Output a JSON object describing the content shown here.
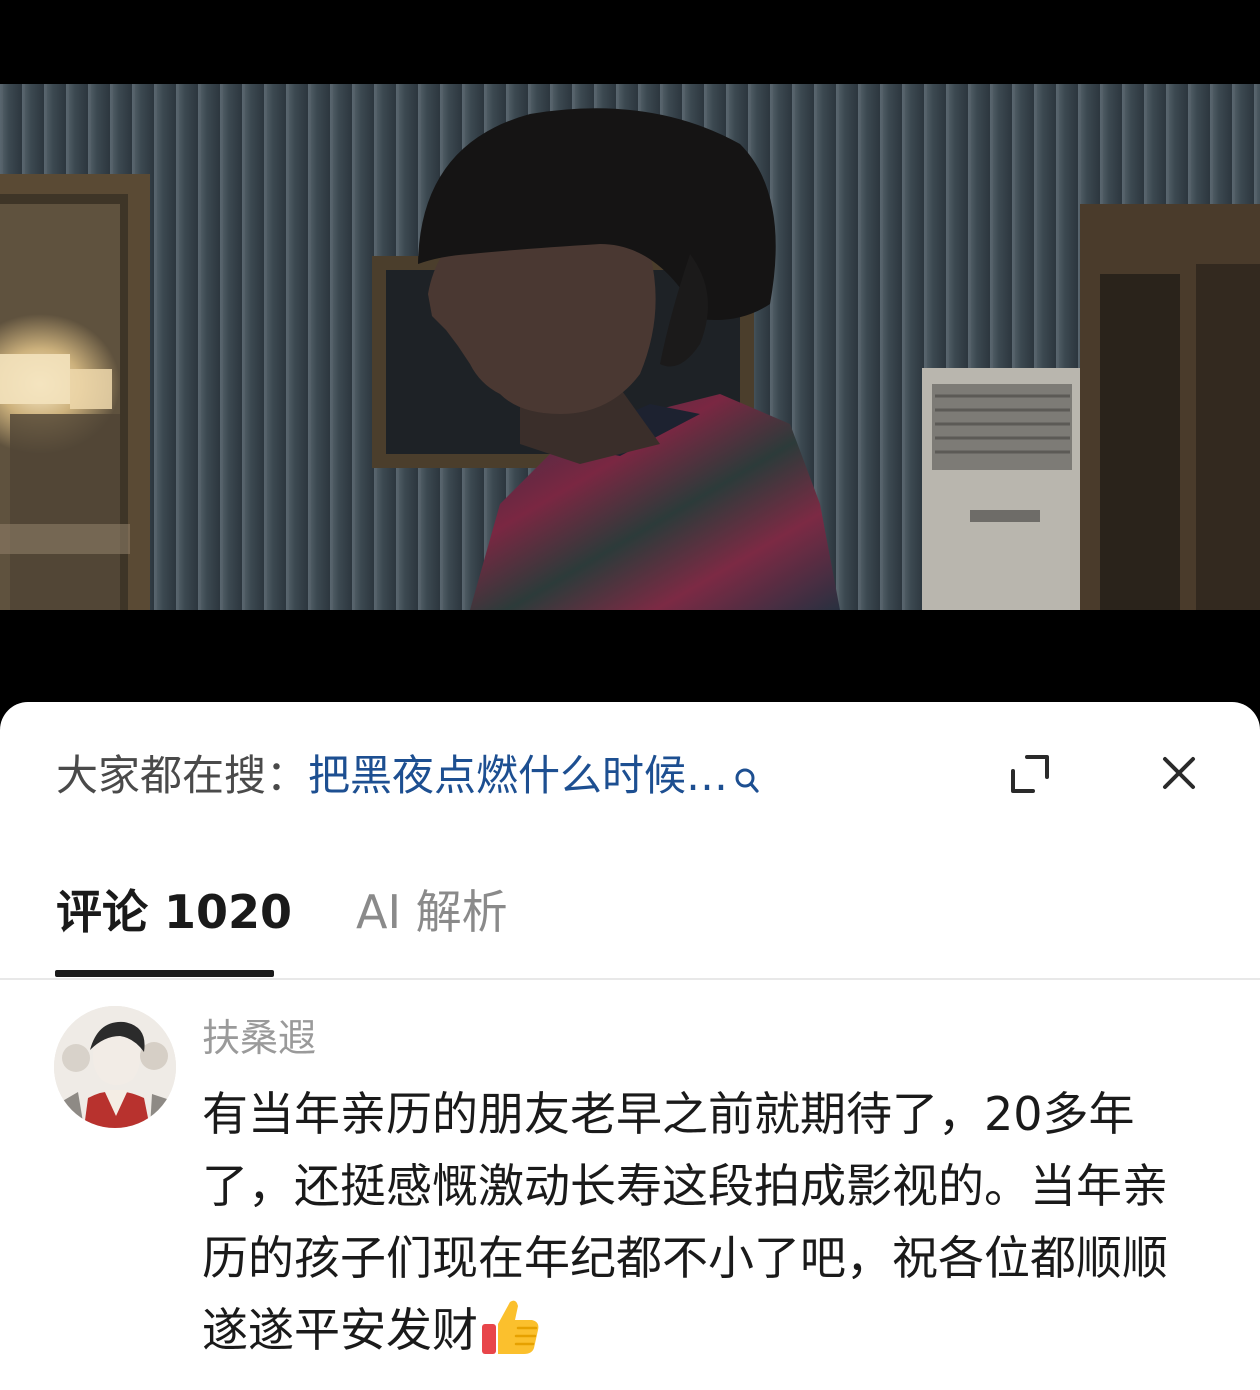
{
  "search": {
    "prefix": "大家都在搜：",
    "query": "把黑夜点燃什么时候…",
    "icon": "search-icon"
  },
  "header": {
    "expand_icon": "expand-icon",
    "close_icon": "close-icon"
  },
  "tabs": [
    {
      "label": "评论 1020",
      "active": true
    },
    {
      "label": "AI 解析",
      "active": false
    }
  ],
  "comment": {
    "author": "扶桑遐",
    "text": "有当年亲历的朋友老早之前就期待了，20多年了，还挺感慨激动长寿这段拍成影视的。当年亲历的孩子们现在年纪都不小了吧，祝各位都顺顺遂遂平安发财",
    "emoji": "thumbs-up-icon"
  },
  "colors": {
    "query_link": "#1d4f91",
    "tab_active": "#1a1a1a",
    "tab_inactive": "#8a8a8a",
    "author": "#9a9a9a"
  }
}
